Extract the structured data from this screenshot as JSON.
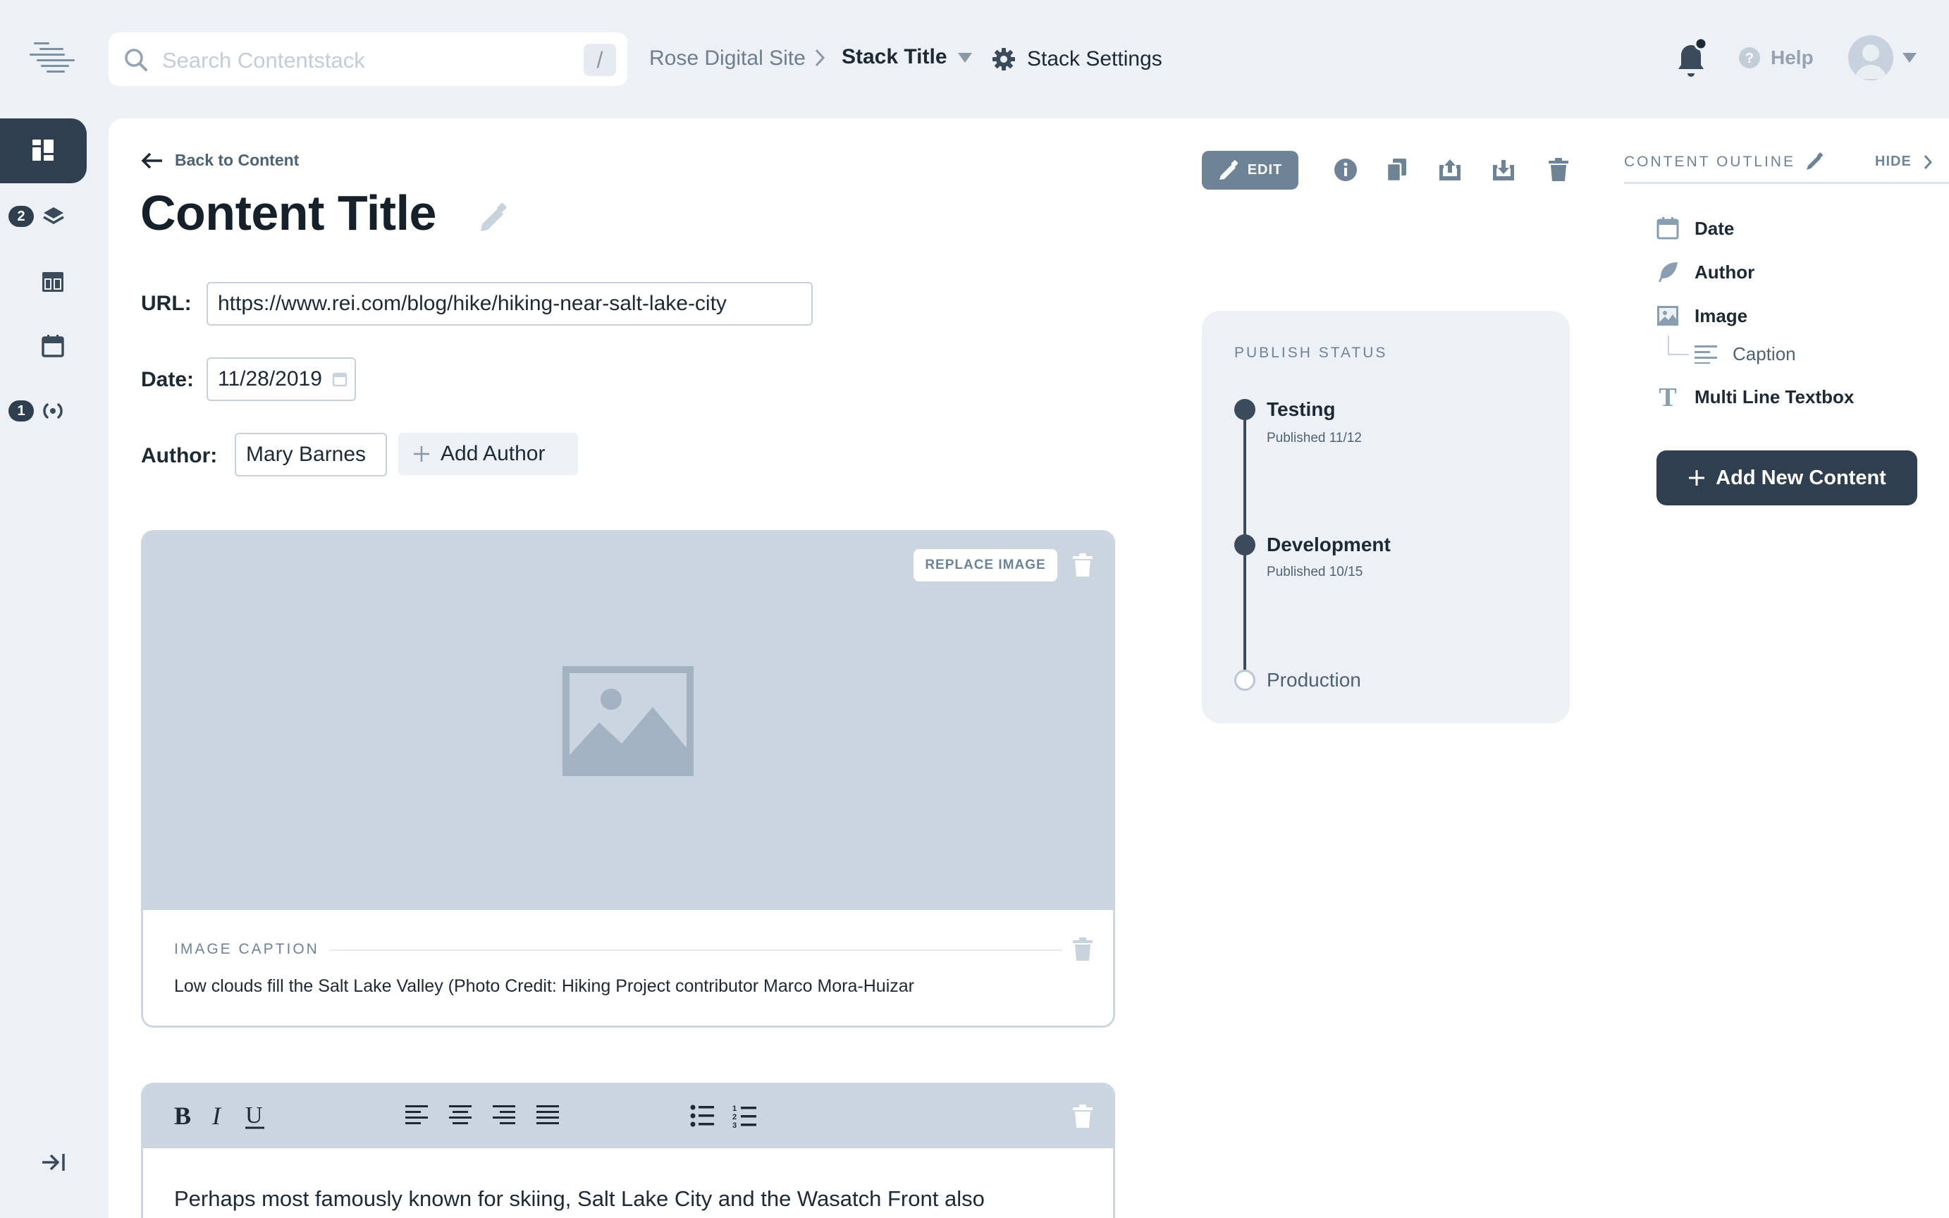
{
  "search": {
    "placeholder": "Search Contentstack",
    "shortcut": "/"
  },
  "breadcrumb": {
    "site": "Rose Digital Site",
    "stack": "Stack Title",
    "settings": "Stack Settings"
  },
  "header": {
    "help": "Help"
  },
  "rail": {
    "badges": [
      "2",
      "1"
    ]
  },
  "content": {
    "back": "Back to Content",
    "title": "Content Title",
    "url_label": "URL:",
    "url_value": "https://www.rei.com/blog/hike/hiking-near-salt-lake-city",
    "date_label": "Date:",
    "date_value": "11/28/2019",
    "author_label": "Author:",
    "author_value": "Mary Barnes",
    "add_author": "Add Author"
  },
  "image": {
    "replace": "REPLACE IMAGE",
    "caption_label": "IMAGE CAPTION",
    "caption_text": "Low clouds fill the Salt Lake Valley (Photo Credit: Hiking Project contributor Marco Mora-Huizar"
  },
  "rte": {
    "text": "Perhaps most famously known for skiing, Salt Lake City and the Wasatch Front also"
  },
  "actions": {
    "edit": "EDIT"
  },
  "publish": {
    "title": "PUBLISH STATUS",
    "stages": [
      {
        "name": "Testing",
        "sub": "Published 11/12"
      },
      {
        "name": "Development",
        "sub": "Published 10/15"
      },
      {
        "name": "Production",
        "sub": ""
      }
    ]
  },
  "outline": {
    "title": "CONTENT OUTLINE",
    "hide": "HIDE",
    "items": [
      "Date",
      "Author",
      "Image",
      "Caption",
      "Multi Line Textbox"
    ],
    "add_new": "Add New Content"
  },
  "colors": {
    "accent_dark": "#2f3f4f",
    "muted": "#6e8398",
    "panel_bg": "#edf1f6"
  }
}
